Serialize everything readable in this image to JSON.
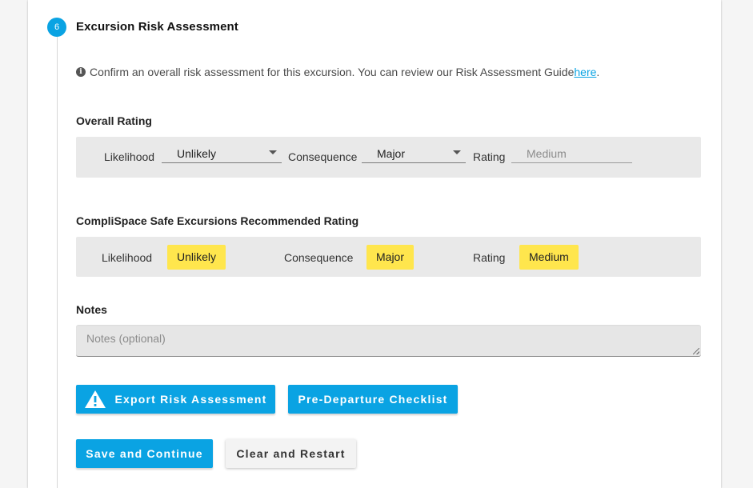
{
  "step": {
    "number": "6",
    "title": "Excursion Risk Assessment"
  },
  "info": {
    "icon": "info-icon",
    "text": "Confirm an overall risk assessment for this excursion. You can review our Risk Assessment Guide ",
    "link": "here",
    "suffix": "."
  },
  "overall": {
    "heading": "Overall Rating",
    "likelihood_label": "Likelihood",
    "likelihood_value": "Unlikely",
    "consequence_label": "Consequence",
    "consequence_value": "Major",
    "rating_label": "Rating",
    "rating_value": "Medium"
  },
  "recommended": {
    "heading": "CompliSpace Safe Excursions Recommended Rating",
    "likelihood_label": "Likelihood",
    "likelihood_value": "Unlikely",
    "consequence_label": "Consequence",
    "consequence_value": "Major",
    "rating_label": "Rating",
    "rating_value": "Medium",
    "badge_color": "#ffe64d"
  },
  "notes": {
    "heading": "Notes",
    "placeholder": "Notes (optional)"
  },
  "buttons": {
    "export": "Export Risk Assessment",
    "checklist": "Pre-Departure Checklist",
    "save": "Save and Continue",
    "clear": "Clear and Restart"
  },
  "colors": {
    "accent": "#0aa3e3",
    "panel": "#e9e9e9"
  }
}
